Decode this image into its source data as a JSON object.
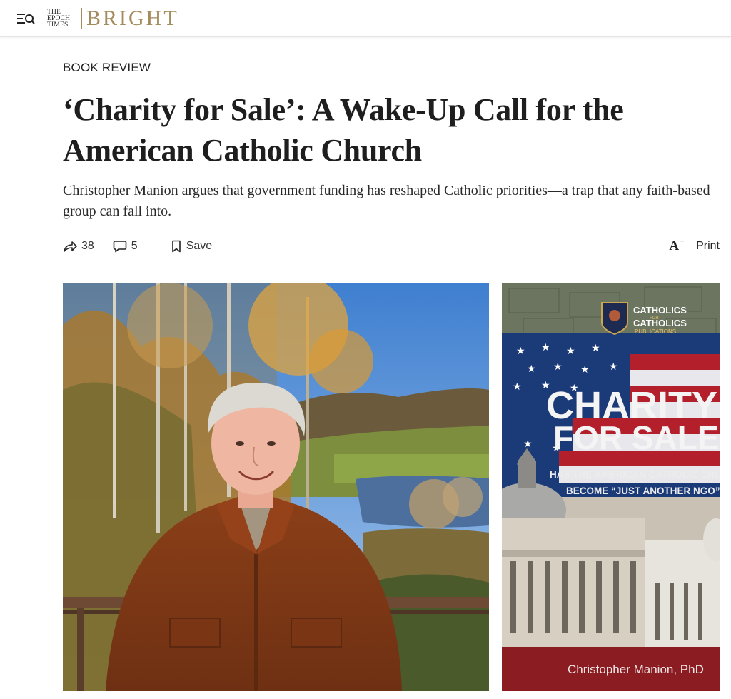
{
  "header": {
    "logo_small_line1": "THE",
    "logo_small_line2": "EPOCH",
    "logo_small_line3": "TIMES",
    "logo_brand": "BRIGHT",
    "brand_color": "#a38b5b"
  },
  "article": {
    "kicker": "BOOK REVIEW",
    "headline": "‘Charity for Sale’: A Wake-Up Call for the American Catholic Church",
    "subhead": "Christopher Manion argues that government funding has reshaped Catholic priorities—a trap that any faith-based group can fall into."
  },
  "actions": {
    "share_count": "38",
    "comment_count": "5",
    "save_label": "Save",
    "font_size_label": "A",
    "print_label": "Print"
  },
  "icons": {
    "menu": "menu-search-icon",
    "share": "share-arrow-icon",
    "comment": "comment-bubble-icon",
    "save": "bookmark-icon",
    "font": "font-size-icon"
  },
  "cover": {
    "publisher_line1": "CATHOLICS",
    "publisher_line2": "FOR",
    "publisher_line3": "CATHOLICS",
    "publisher_line4": "PUBLICATIONS",
    "title_line1": "CHARITY",
    "title_line2": "FOR SALE",
    "subtitle_line1": "HAS THE AMERICAN CATHOLIC CHURCH",
    "subtitle_line2": "BECOME “JUST ANOTHER NGO”?",
    "author": "Christopher Manion, PhD"
  }
}
